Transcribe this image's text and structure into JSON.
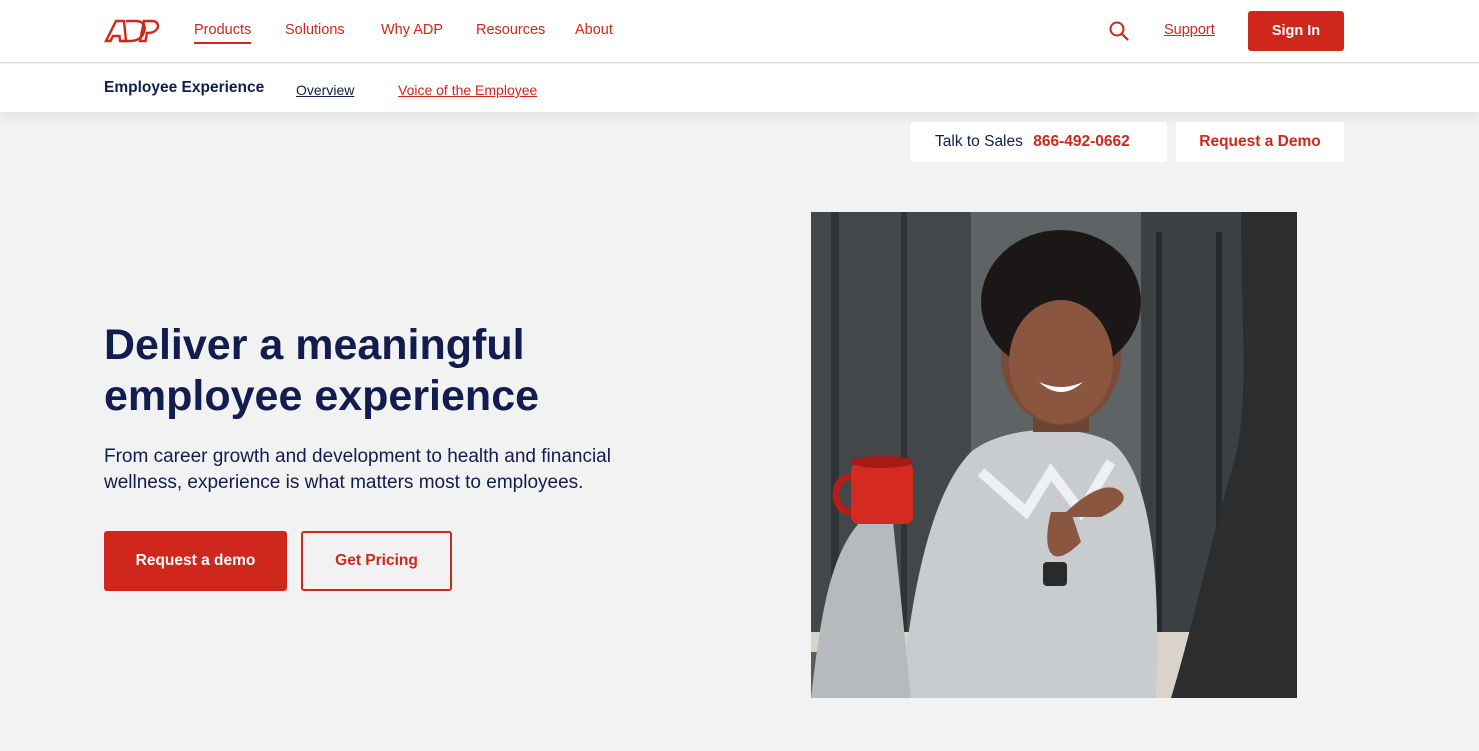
{
  "brand": {
    "logo_text": "ADP",
    "accent_color": "#d0271d",
    "navy_color": "#121c4e"
  },
  "topnav": {
    "items": [
      {
        "label": "Products",
        "active": true
      },
      {
        "label": "Solutions"
      },
      {
        "label": "Why ADP"
      },
      {
        "label": "Resources"
      },
      {
        "label": "About"
      }
    ],
    "search_icon": "search-icon",
    "support_label": "Support",
    "signin_label": "Sign In"
  },
  "subnav": {
    "title": "Employee Experience",
    "links": [
      {
        "label": "Overview"
      },
      {
        "label": "Voice of the Employee"
      }
    ]
  },
  "contact": {
    "sales_label": "Talk to Sales",
    "sales_phone": "866-492-0662",
    "demo_label": "Request a Demo"
  },
  "hero": {
    "headline": "Deliver a meaningful employee experience",
    "subtext": "From career growth and development to health and financial wellness, experience is what matters most to employees.",
    "primary_cta": "Request a demo",
    "secondary_cta": "Get Pricing",
    "image_subject": "smiling woman holding red mug in office"
  }
}
